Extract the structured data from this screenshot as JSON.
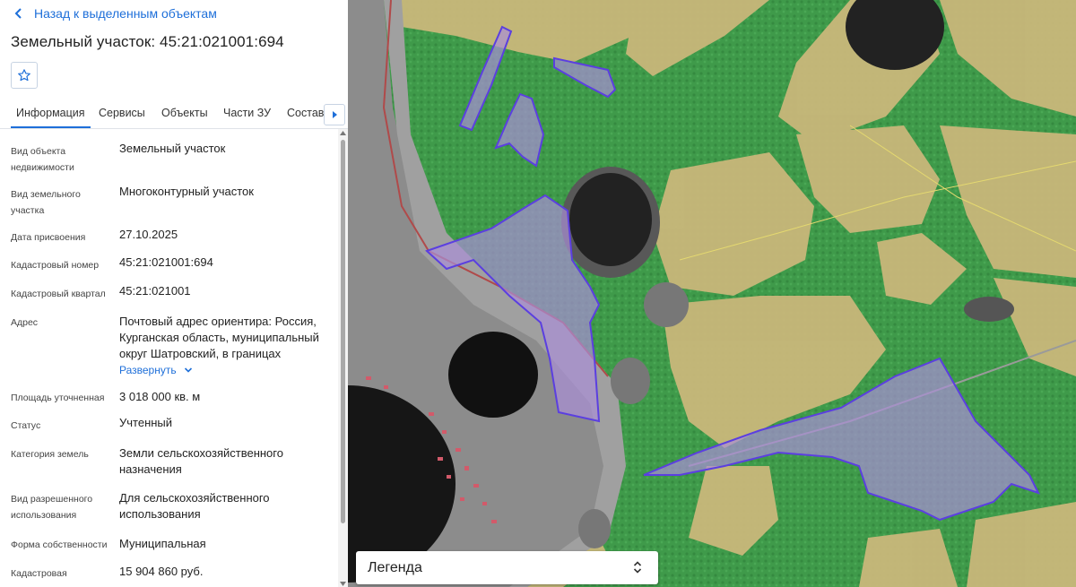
{
  "back_link": "Назад к выделенным объектам",
  "title": "Земельный участок: 45:21:021001:694",
  "tabs": [
    {
      "label": "Информация",
      "active": true
    },
    {
      "label": "Сервисы",
      "active": false
    },
    {
      "label": "Объекты",
      "active": false
    },
    {
      "label": "Части ЗУ",
      "active": false
    },
    {
      "label": "Состав",
      "active": false
    }
  ],
  "fields": {
    "object_type": {
      "label1": "Вид объекта",
      "label2": "недвижимости",
      "value": "Земельный участок"
    },
    "plot_type": {
      "label1": "Вид земельного",
      "label2": "участка",
      "value": "Многоконтурный участок"
    },
    "assign_date": {
      "label": "Дата присвоения",
      "value": "27.10.2025"
    },
    "cad_number": {
      "label": "Кадастровый номер",
      "value": "45:21:021001:694"
    },
    "cad_quarter": {
      "label": "Кадастровый квартал",
      "value": "45:21:021001"
    },
    "address": {
      "label": "Адрес",
      "line1": "Почтовый адрес ориентира: Россия,",
      "line2": "Курганская область, муниципальный",
      "line3": "округ Шатровский, в границах",
      "expand": "Развернуть"
    },
    "area": {
      "label": "Площадь уточненная",
      "value": "3 018 000 кв. м"
    },
    "status": {
      "label": "Статус",
      "value": "Учтенный"
    },
    "land_category": {
      "label": "Категория земель",
      "line1": "Земли сельскохозяйственного",
      "line2": "назначения"
    },
    "permitted_use": {
      "label1": "Вид разрешенного",
      "label2": "использования",
      "line1": "Для сельскохозяйственного",
      "line2": "использования"
    },
    "ownership": {
      "label": "Форма собственности",
      "value": "Муниципальная"
    },
    "cad_value": {
      "label": "Кадастровая",
      "value": "15 904 860 руб."
    }
  },
  "legend_label": "Легенда",
  "colors": {
    "accent": "#1e6fd9",
    "forest": "#3f9a4a",
    "field": "#c9b77a",
    "parcel_fill": "#a98fd6",
    "parcel_stroke": "#5b3fe0"
  },
  "icons": [
    "chevron-left-icon",
    "star-icon",
    "chevron-right-icon",
    "chevron-down-icon",
    "up-down-icon"
  ]
}
